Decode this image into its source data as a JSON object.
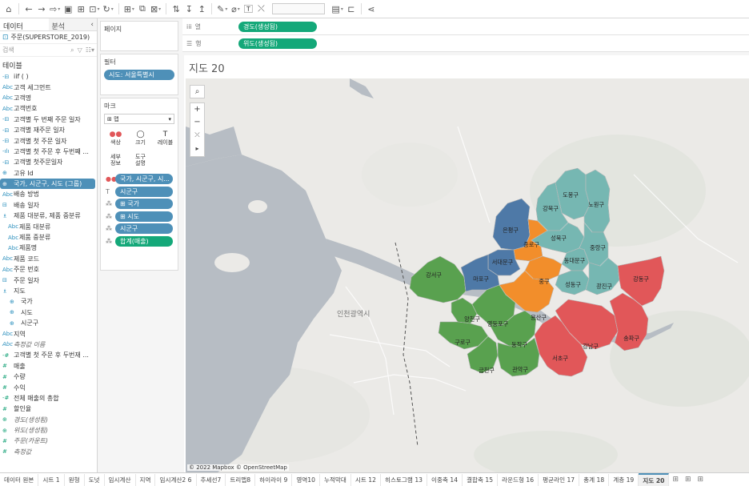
{
  "toolbar": {
    "undo_icon": "undo-icon",
    "redo_icon": "redo-icon"
  },
  "left_pane": {
    "tab_data": "데이터",
    "tab_analysis": "분석",
    "collapse": "‹",
    "datasource": "주문(SUPERSTORE_2019)",
    "search_placeholder": "검색",
    "section_tables": "테이블",
    "fields": [
      {
        "icon": "-⊟",
        "kind": "dim",
        "label": "iif ( )"
      },
      {
        "icon": "Abc",
        "kind": "dim",
        "label": "고객 세그먼트"
      },
      {
        "icon": "Abc",
        "kind": "dim",
        "label": "고객명"
      },
      {
        "icon": "Abc",
        "kind": "dim",
        "label": "고객번호"
      },
      {
        "icon": "-⊟",
        "kind": "dim",
        "label": "고객별 두 번째 주문 일자"
      },
      {
        "icon": "-⊟",
        "kind": "dim",
        "label": "고객별 재주문 일자"
      },
      {
        "icon": "-⊟",
        "kind": "dim",
        "label": "고객별 첫 주문 일자"
      },
      {
        "icon": "-ılı",
        "kind": "dim",
        "label": "고객별 첫 주문 후 두번째 ..."
      },
      {
        "icon": "-⊟",
        "kind": "dim",
        "label": "고객별 첫주문일자"
      },
      {
        "icon": "⊕",
        "kind": "dim",
        "label": "고유 Id"
      },
      {
        "icon": "⊕",
        "kind": "dim",
        "label": "국가, 시군구, 시도 (그룹)",
        "selected": true
      },
      {
        "icon": "Abc",
        "kind": "dim",
        "label": "배송 방법"
      },
      {
        "icon": "⊟",
        "kind": "dim",
        "label": "배송 일자"
      },
      {
        "icon": "♗",
        "kind": "dim",
        "label": "제품 대분류, 제품 중분류"
      },
      {
        "icon": "Abc",
        "kind": "dim",
        "label": "제품 대분류",
        "indent": 1
      },
      {
        "icon": "Abc",
        "kind": "dim",
        "label": "제품 중분류",
        "indent": 1
      },
      {
        "icon": "Abc",
        "kind": "dim",
        "label": "제품명",
        "indent": 1
      },
      {
        "icon": "Abc",
        "kind": "dim",
        "label": "제품 코드"
      },
      {
        "icon": "Abc",
        "kind": "dim",
        "label": "주문 번호"
      },
      {
        "icon": "⊟",
        "kind": "dim",
        "label": "주문 일자"
      },
      {
        "icon": "♗",
        "kind": "dim",
        "label": "지도"
      },
      {
        "icon": "⊕",
        "kind": "dim",
        "label": "국가",
        "indent": 2
      },
      {
        "icon": "⊕",
        "kind": "dim",
        "label": "시도",
        "indent": 2
      },
      {
        "icon": "⊕",
        "kind": "dim",
        "label": "시군구",
        "indent": 2
      },
      {
        "icon": "Abc",
        "kind": "dim",
        "label": "지역"
      },
      {
        "icon": "Abc",
        "kind": "dim",
        "label": "측정값 이름",
        "italic": true
      },
      {
        "icon": "-#",
        "kind": "mea",
        "label": "고객별 첫 주문 후 두번재 ..."
      },
      {
        "icon": "#",
        "kind": "mea",
        "label": "매출"
      },
      {
        "icon": "#",
        "kind": "mea",
        "label": "수량"
      },
      {
        "icon": "#",
        "kind": "mea",
        "label": "수익"
      },
      {
        "icon": "-#",
        "kind": "mea",
        "label": "전체 매출의 총합"
      },
      {
        "icon": "#",
        "kind": "mea",
        "label": "할인율"
      },
      {
        "icon": "⊕",
        "kind": "mea",
        "label": "경도(생성됨)",
        "italic": true
      },
      {
        "icon": "⊕",
        "kind": "mea",
        "label": "위도(생성됨)",
        "italic": true
      },
      {
        "icon": "#",
        "kind": "mea",
        "label": "주문(카운트)",
        "italic": true
      },
      {
        "icon": "#",
        "kind": "mea",
        "label": "측정값",
        "italic": true
      }
    ]
  },
  "shelves": {
    "pages_label": "페이지",
    "filters_label": "필터",
    "filter_pill": "시도: 서울특별시",
    "marks_label": "마크",
    "mark_type": "맵",
    "mark_buttons": [
      {
        "glyph": "●●",
        "label": "색상"
      },
      {
        "glyph": "◯",
        "label": "크기"
      },
      {
        "glyph": "T",
        "label": "레이블"
      },
      {
        "glyph": "",
        "label": "세부\n정보"
      },
      {
        "glyph": "",
        "label": "도구\n설명"
      }
    ],
    "mark_pills": [
      {
        "icon": "●●",
        "label": "국가, 시군구, 시...",
        "color": "blue"
      },
      {
        "icon": "T",
        "label": "시군구",
        "color": "blue"
      },
      {
        "icon": "⁂",
        "label": "⊞ 국가",
        "color": "blue"
      },
      {
        "icon": "⁂",
        "label": "⊞ 시도",
        "color": "blue"
      },
      {
        "icon": "⁂",
        "label": "시군구",
        "color": "blue"
      },
      {
        "icon": "⁂",
        "label": "합계(매출)",
        "color": "green"
      }
    ],
    "columns_label": "열",
    "columns_pill": "경도(생성됨)",
    "rows_label": "행",
    "rows_pill": "위도(생성됨)"
  },
  "viz": {
    "title": "지도 20",
    "attribution": "© 2022 Mapbox © OpenStreetMap",
    "incheon_label": "인천광역시",
    "colors": {
      "green": "#59a14f",
      "blue": "#4e79a7",
      "orange": "#f28e2b",
      "teal": "#76b7b2",
      "red": "#e15759"
    },
    "districts": [
      {
        "name": "도봉구",
        "group": "teal"
      },
      {
        "name": "노원구",
        "group": "teal"
      },
      {
        "name": "강북구",
        "group": "teal"
      },
      {
        "name": "은평구",
        "group": "blue"
      },
      {
        "name": "성북구",
        "group": "teal"
      },
      {
        "name": "종로구",
        "group": "orange"
      },
      {
        "name": "중랑구",
        "group": "teal"
      },
      {
        "name": "서대문구",
        "group": "blue"
      },
      {
        "name": "동대문구",
        "group": "teal"
      },
      {
        "name": "강서구",
        "group": "green"
      },
      {
        "name": "마포구",
        "group": "blue"
      },
      {
        "name": "중구",
        "group": "orange"
      },
      {
        "name": "성동구",
        "group": "teal"
      },
      {
        "name": "광진구",
        "group": "teal"
      },
      {
        "name": "강동구",
        "group": "red"
      },
      {
        "name": "양천구",
        "group": "green"
      },
      {
        "name": "용산구",
        "group": "orange"
      },
      {
        "name": "영등포구",
        "group": "green"
      },
      {
        "name": "구로구",
        "group": "green"
      },
      {
        "name": "동작구",
        "group": "green"
      },
      {
        "name": "강남구",
        "group": "red"
      },
      {
        "name": "송파구",
        "group": "red"
      },
      {
        "name": "서초구",
        "group": "red"
      },
      {
        "name": "금천구",
        "group": "green"
      },
      {
        "name": "관악구",
        "group": "green"
      }
    ]
  },
  "bottom_tabs": [
    {
      "label": "데이터 원본"
    },
    {
      "label": "시트 1"
    },
    {
      "label": "원형"
    },
    {
      "label": "도넛"
    },
    {
      "label": "임시계산"
    },
    {
      "label": "지역"
    },
    {
      "label": "임시계산2 6"
    },
    {
      "label": "추세선7"
    },
    {
      "label": "트리맵8"
    },
    {
      "label": "하이라이 9"
    },
    {
      "label": "영역10"
    },
    {
      "label": "누적막대"
    },
    {
      "label": "시트 12"
    },
    {
      "label": "히스토그램 13"
    },
    {
      "label": "이중축 14"
    },
    {
      "label": "결합축 15"
    },
    {
      "label": "라운드형 16"
    },
    {
      "label": "평균라인 17"
    },
    {
      "label": "총계 18"
    },
    {
      "label": "계층 19"
    },
    {
      "label": "지도 20",
      "active": true
    }
  ]
}
